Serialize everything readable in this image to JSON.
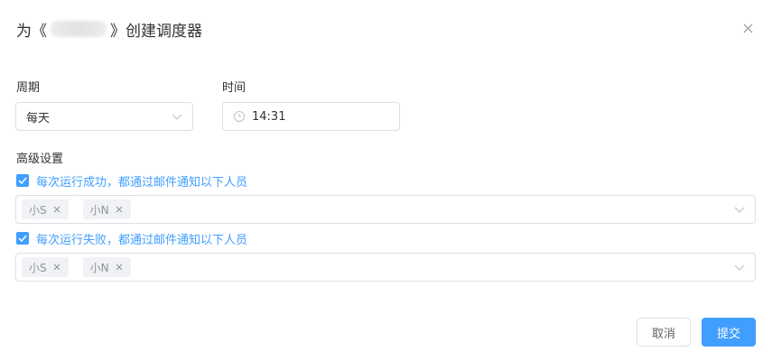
{
  "dialog": {
    "title_prefix": "为《",
    "title_suffix": "》创建调度器"
  },
  "schedule": {
    "period_label": "周期",
    "period_value": "每天",
    "time_label": "时间",
    "time_value": "14:31"
  },
  "advanced": {
    "label": "高级设置",
    "success": {
      "label": "每次运行成功，都通过邮件通知以下人员",
      "checked": true,
      "recipients": [
        "小S",
        "小N"
      ]
    },
    "failure": {
      "label": "每次运行失败，都通过邮件通知以下人员",
      "checked": true,
      "recipients": [
        "小S",
        "小N"
      ]
    }
  },
  "footer": {
    "cancel_label": "取消",
    "submit_label": "提交"
  },
  "colors": {
    "primary": "#409eff",
    "border": "#dcdfe6",
    "tag_bg": "#f0f2f5",
    "text": "#303133"
  },
  "icons": [
    "close-icon",
    "chevron-down-icon",
    "clock-icon",
    "check-icon",
    "tag-close-icon"
  ]
}
